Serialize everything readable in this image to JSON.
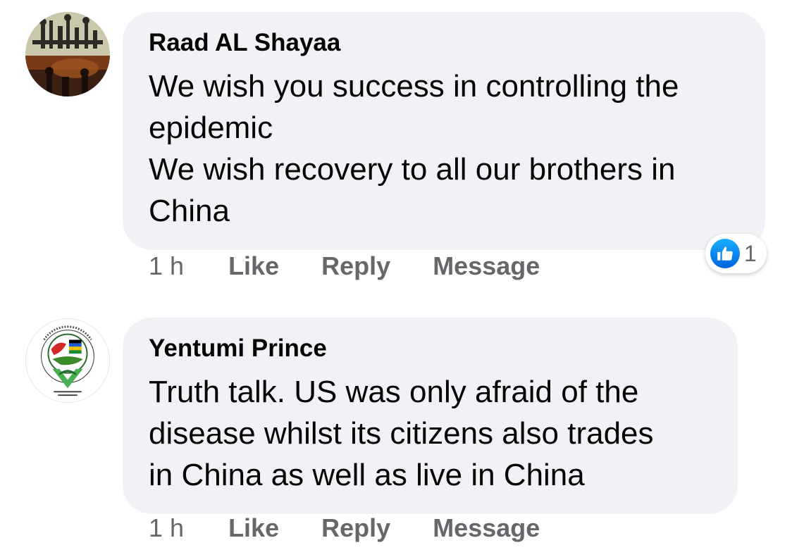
{
  "comments": [
    {
      "author": "Raad AL Shayaa",
      "text_lines": [
        "We wish you success in controlling the",
        "epidemic",
        "We wish recovery to all our brothers in",
        "China"
      ],
      "time": "1 h",
      "actions": [
        "Like",
        "Reply",
        "Message"
      ],
      "reaction_count": "1"
    },
    {
      "author": "Yentumi Prince",
      "text_lines": [
        "Truth talk. US was only afraid of the",
        "disease whilst its citizens also trades",
        "in China as well as live in China"
      ],
      "time": "1 h",
      "actions": [
        "Like",
        "Reply",
        "Message"
      ]
    }
  ],
  "icons": {
    "reaction": "thumbs-up-icon"
  },
  "colors": {
    "bubble": "#f0f2f5",
    "action_text": "#65676b",
    "like_blue": "#1877f2"
  }
}
